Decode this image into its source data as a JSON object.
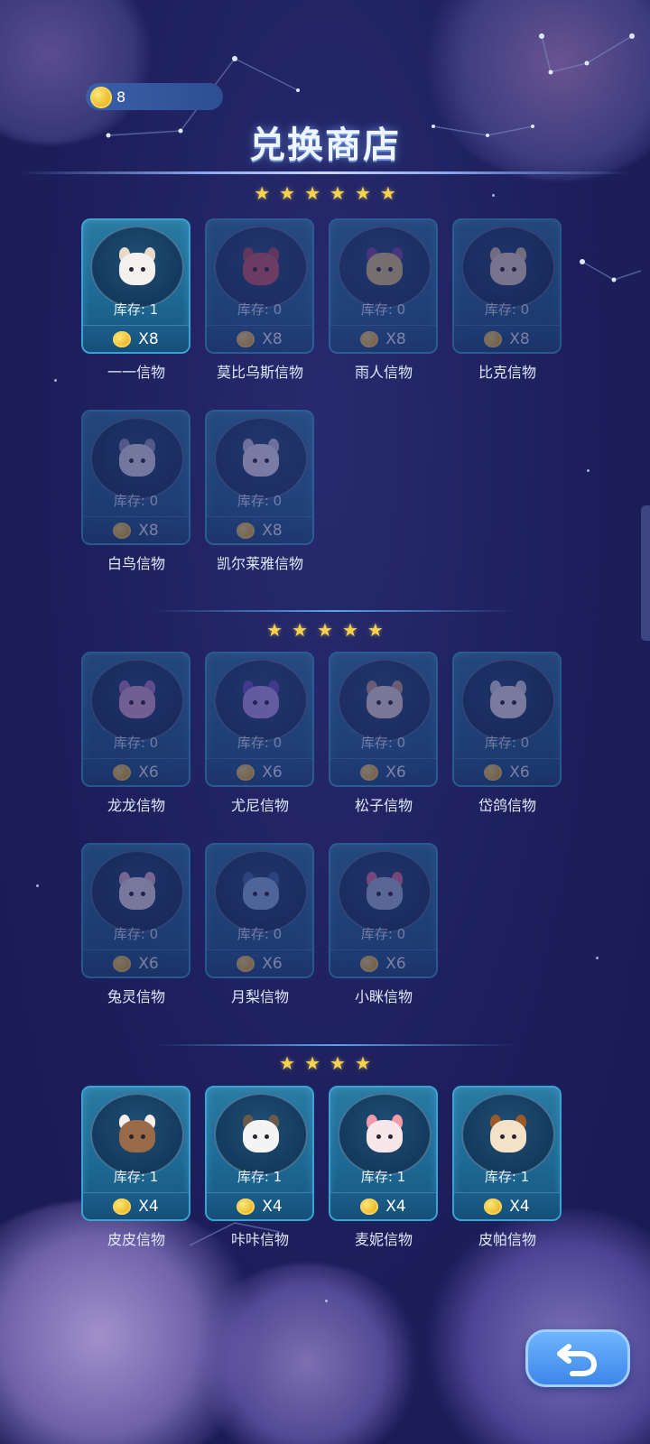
{
  "currency": {
    "amount": "8",
    "icon": "coin-icon"
  },
  "title": "兑换商店",
  "colors": {
    "background": "#1d1f5c",
    "card": "#1d6a95",
    "card_border": "#3aa3d1",
    "star": "#f7d24a",
    "coin": "#e8b524",
    "back_button": "#4a90ee"
  },
  "tiers": [
    {
      "stars": [
        "★",
        "★",
        "★",
        "★",
        "★",
        "★"
      ],
      "items": [
        {
          "name": "一一信物",
          "stock": "库存: 1",
          "price": "X8",
          "available": true,
          "color": "#f4f0ee",
          "accent": "#e9d9c8"
        },
        {
          "name": "莫比乌斯信物",
          "stock": "库存: 0",
          "price": "X8",
          "available": false,
          "color": "#d05a5e",
          "accent": "#b84a4e"
        },
        {
          "name": "雨人信物",
          "stock": "库存: 0",
          "price": "X8",
          "available": false,
          "color": "#e5d37a",
          "accent": "#7c4a9a"
        },
        {
          "name": "比克信物",
          "stock": "库存: 0",
          "price": "X8",
          "available": false,
          "color": "#f2e6cf",
          "accent": "#e6d3a6"
        },
        {
          "name": "白鸟信物",
          "stock": "库存: 0",
          "price": "X8",
          "available": false,
          "color": "#e8eef6",
          "accent": "#9aa8bf"
        },
        {
          "name": "凯尔莱雅信物",
          "stock": "库存: 0",
          "price": "X8",
          "available": false,
          "color": "#eef0f6",
          "accent": "#cfd5e6"
        }
      ]
    },
    {
      "stars": [
        "★",
        "★",
        "★",
        "★",
        "★"
      ],
      "items": [
        {
          "name": "龙龙信物",
          "stock": "库存: 0",
          "price": "X6",
          "available": false,
          "color": "#e6b3d6",
          "accent": "#b786c9"
        },
        {
          "name": "尤尼信物",
          "stock": "库存: 0",
          "price": "X6",
          "available": false,
          "color": "#bda7f0",
          "accent": "#6e55c8"
        },
        {
          "name": "松子信物",
          "stock": "库存: 0",
          "price": "X6",
          "available": false,
          "color": "#f3e7da",
          "accent": "#c9a888"
        },
        {
          "name": "岱鸽信物",
          "stock": "库存: 0",
          "price": "X6",
          "available": false,
          "color": "#f5f5f7",
          "accent": "#e2e6ee"
        },
        {
          "name": "兔灵信物",
          "stock": "库存: 0",
          "price": "X6",
          "available": false,
          "color": "#f4f2f4",
          "accent": "#f1c7d9"
        },
        {
          "name": "月梨信物",
          "stock": "库存: 0",
          "price": "X6",
          "available": false,
          "color": "#8fc1e6",
          "accent": "#3c6fa6"
        },
        {
          "name": "小眯信物",
          "stock": "库存: 0",
          "price": "X6",
          "available": false,
          "color": "#a6c6dc",
          "accent": "#ef7aa0"
        }
      ]
    },
    {
      "stars": [
        "★",
        "★",
        "★",
        "★"
      ],
      "items": [
        {
          "name": "皮皮信物",
          "stock": "库存: 1",
          "price": "X4",
          "available": true,
          "color": "#9a6a48",
          "accent": "#f4efe9"
        },
        {
          "name": "咔咔信物",
          "stock": "库存: 1",
          "price": "X4",
          "available": true,
          "color": "#f4f4f4",
          "accent": "#6a5a4a"
        },
        {
          "name": "麦妮信物",
          "stock": "库存: 1",
          "price": "X4",
          "available": true,
          "color": "#f7e6ea",
          "accent": "#f39aa8"
        },
        {
          "name": "皮帕信物",
          "stock": "库存: 1",
          "price": "X4",
          "available": true,
          "color": "#f3e2c7",
          "accent": "#9a5a2a"
        }
      ]
    }
  ],
  "back_button": {
    "icon": "undo-arrow-icon"
  }
}
